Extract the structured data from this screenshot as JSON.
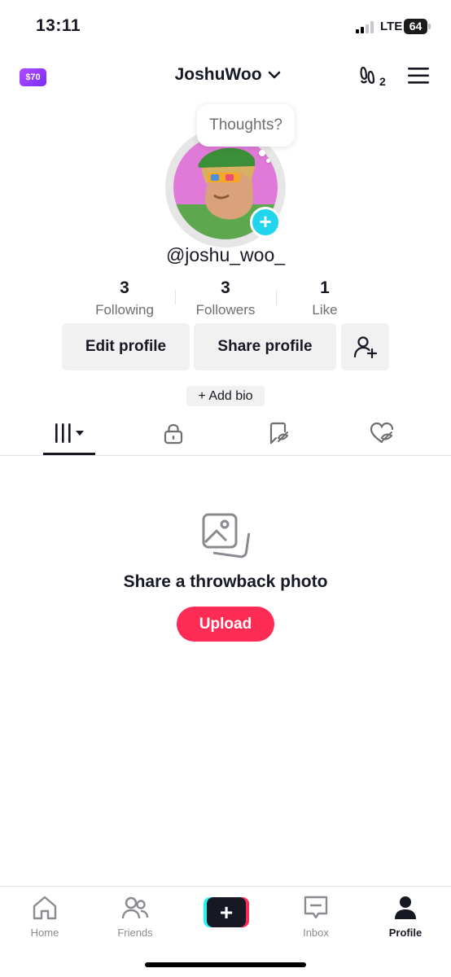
{
  "status_bar": {
    "time": "13:11",
    "network": "LTE",
    "battery": "64"
  },
  "header": {
    "coin_label": "$70",
    "username": "JoshuWoo",
    "badge_count": "2"
  },
  "profile": {
    "thought_bubble": "Thoughts?",
    "handle": "@joshu_woo_",
    "add_bio": "+ Add bio"
  },
  "stats": [
    {
      "value": "3",
      "label": "Following"
    },
    {
      "value": "3",
      "label": "Followers"
    },
    {
      "value": "1",
      "label": "Like"
    }
  ],
  "buttons": {
    "edit_profile": "Edit profile",
    "share_profile": "Share profile"
  },
  "tabs": [
    "videos-grid-icon",
    "lock-icon",
    "reposts-icon",
    "liked-icon"
  ],
  "empty_state": {
    "title": "Share a throwback photo",
    "button": "Upload"
  },
  "bottom_nav": [
    {
      "label": "Home"
    },
    {
      "label": "Friends"
    },
    {
      "label": ""
    },
    {
      "label": "Inbox"
    },
    {
      "label": "Profile"
    }
  ],
  "colors": {
    "accent": "#fe2c55",
    "cyan": "#25f4ee",
    "badge": "#20d5ec",
    "coin": "#8f3bf7"
  }
}
